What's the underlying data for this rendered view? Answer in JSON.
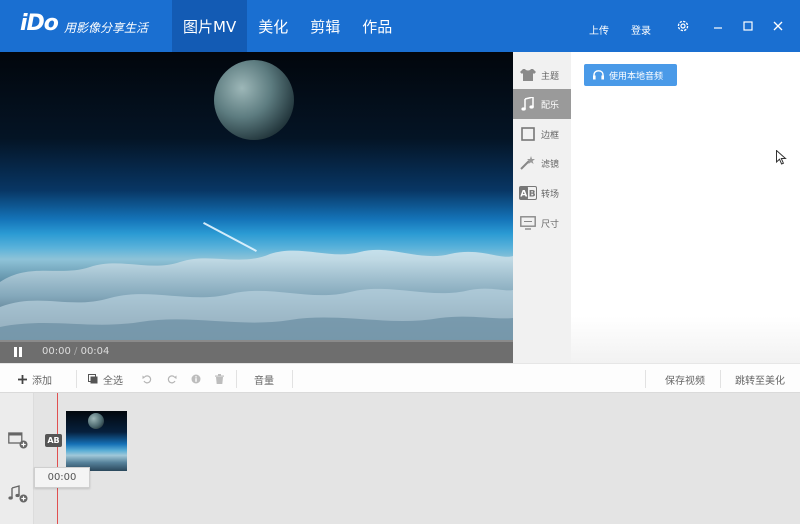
{
  "header": {
    "logo": "iDo",
    "slogan": "用影像分享生活",
    "nav": [
      {
        "label": "图片MV",
        "active": true
      },
      {
        "label": "美化",
        "active": false
      },
      {
        "label": "剪辑",
        "active": false
      },
      {
        "label": "作品",
        "active": false
      }
    ],
    "upload": "上传",
    "login": "登录",
    "icons": [
      "gear-icon",
      "minimize-icon",
      "maximize-icon",
      "close-icon"
    ]
  },
  "player": {
    "current_time": "00:00",
    "separator": "/",
    "total_time": "00:04",
    "progress": 0
  },
  "side_tabs": [
    {
      "label": "主题",
      "icon": "tshirt-icon"
    },
    {
      "label": "配乐",
      "icon": "music-note-icon",
      "active": true
    },
    {
      "label": "边框",
      "icon": "frame-icon"
    },
    {
      "label": "滤镜",
      "icon": "magic-wand-icon"
    },
    {
      "label": "转场",
      "icon": "transition-ab-icon"
    },
    {
      "label": "尺寸",
      "icon": "screen-size-icon"
    }
  ],
  "panel": {
    "music_button": "使用本地音频"
  },
  "toolbar": {
    "add": "添加",
    "select_all": "全选",
    "volume": "音量",
    "save_video": "保存视频",
    "goto_beautify": "跳转至美化"
  },
  "timeline": {
    "transition_badge": "AB",
    "playhead_time": "00:00"
  },
  "colors": {
    "header_bg": "#1a6fd1",
    "nav_active": "#135bb4",
    "accent_button": "#4a9ae8",
    "playhead": "#e05050"
  }
}
